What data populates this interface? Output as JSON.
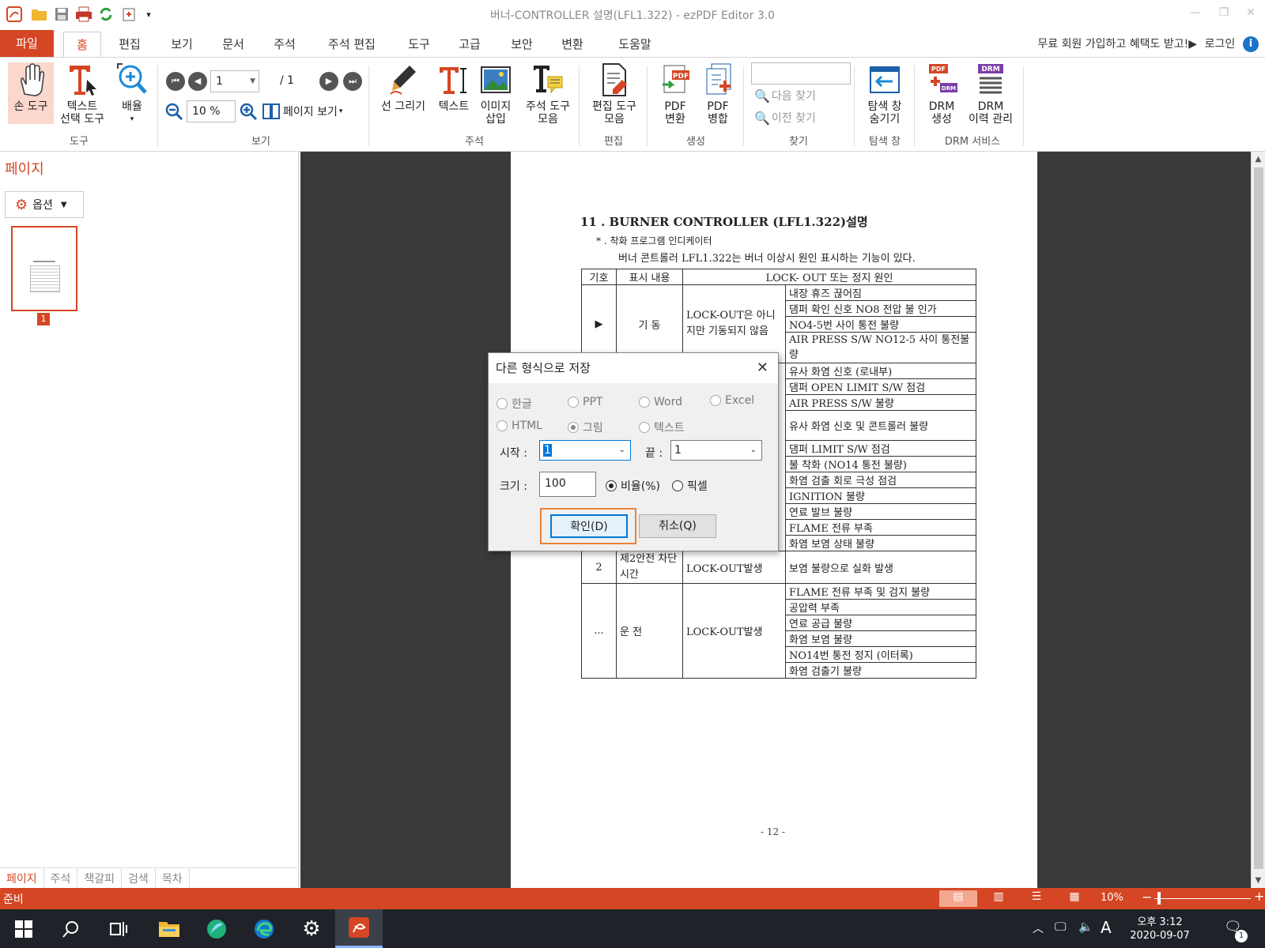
{
  "titlebar": {
    "title": "버너-CONTROLLER 설명(LFL1.322) - ezPDF Editor 3.0",
    "quick_access": [
      "app-logo-icon",
      "open-folder-icon",
      "save-icon",
      "print-icon",
      "refresh-icon",
      "new-doc-icon",
      "customize-dropdown-icon"
    ]
  },
  "menubar": {
    "file": "파일",
    "tabs": [
      "홈",
      "편집",
      "보기",
      "문서",
      "주석",
      "주석 편집",
      "도구",
      "고급",
      "보안",
      "변환",
      "도움말"
    ],
    "promo": "무료 회원 가입하고 혜택도 받고!▶",
    "login": "로그인"
  },
  "ribbon": {
    "hand_tool": "손 도구",
    "text_select_1": "텍스트",
    "text_select_2": "선택 도구",
    "zoom_1": "배율",
    "group_tools": "도구",
    "page_input": "1",
    "page_total": "/ 1",
    "zoom_value": "10 %",
    "page_view": "페이지 보기",
    "group_view": "보기",
    "line_draw": "선 그리기",
    "text": "텍스트",
    "image_insert_1": "이미지",
    "image_insert_2": "삽입",
    "note_tools_1": "주석 도구",
    "note_tools_2": "모음",
    "group_annot": "주석",
    "edit_tools_1": "편집 도구",
    "edit_tools_2": "모음",
    "group_edit": "편집",
    "pdf_convert_1": "PDF",
    "pdf_convert_2": "변환",
    "pdf_merge_1": "PDF",
    "pdf_merge_2": "병합",
    "group_create": "생성",
    "find_next": "다음 찾기",
    "find_prev": "이전 찾기",
    "group_find": "찾기",
    "hide_nav_1": "탐색 창",
    "hide_nav_2": "숨기기",
    "group_nav": "탐색 창",
    "drm_create_1": "DRM",
    "drm_create_2": "생성",
    "drm_history_1": "DRM",
    "drm_history_2": "이력 관리",
    "group_drm": "DRM 서비스",
    "pdf_badge": "PDF",
    "drm_badge": "DRM"
  },
  "leftpanel": {
    "title": "페이지",
    "options": "옵션",
    "thumb_num": "1",
    "bottom_tabs": [
      "페이지",
      "주석",
      "책갈피",
      "검색",
      "목차"
    ]
  },
  "document": {
    "heading": "11 . BURNER CONTROLLER (LFL1.322)설명",
    "sub1": "* . 착화 프로그램 인디케이터",
    "sub2": "버너 콘트롤러 LFL1.322는 버너 이상시 원인 표시하는 기능이 있다.",
    "header": [
      "기호",
      "표시 내용",
      "LOCK- OUT 또는 정지 원인"
    ],
    "sec1_symbol": "▶",
    "sec1_label": "기   동",
    "sec1_status": "LOCK-OUT은 아니지만 기동되지 않음",
    "sec1_causes": [
      "내장 휴즈 끊어짐",
      "댐퍼 확인 신호 NO8 전압 불 인가",
      "NO4-5번 사이 통전 불량",
      "AIR PRESS S/W NO12-5 사이 통전불량"
    ],
    "mid_causes": [
      "유사 화염 신호 (로내부)",
      "댐퍼 OPEN LIMIT S/W 점검",
      "AIR PRESS S/W 불량",
      "유사 화염 신호 및 콘트롤러 불량",
      "댐퍼 LIMIT S/W 점검",
      "불 착화 (NO14 통전 불량)",
      "화염 검출 회로 극성 점검",
      "IGNITION 불량",
      "연료 발브 불량",
      "FLAME 전류 부족",
      "화염 보염 상태 불량"
    ],
    "sec2_symbol": "2",
    "sec2_label": "제2안전 차단 시간",
    "sec2_status": "LOCK-OUT발생",
    "sec2_cause": "보염 불량으로 실화 발생",
    "sec3_symbol": "...",
    "sec3_label": "운   전",
    "sec3_status": "LOCK-OUT발생",
    "sec3_causes": [
      "FLAME 전류 부족 및 검지 불량",
      "공압력 부족",
      "연료 공급 불량",
      "화염 보염 불량",
      "NO14번 통전 정지 (이터록)",
      "화염 검출기 불량"
    ],
    "page_footer": "- 12 -"
  },
  "dialog": {
    "title": "다른 형식으로 저장",
    "formats": [
      {
        "label": "한글",
        "selected": false,
        "enabled": false
      },
      {
        "label": "PPT",
        "selected": false,
        "enabled": false
      },
      {
        "label": "Word",
        "selected": false,
        "enabled": false
      },
      {
        "label": "Excel",
        "selected": false,
        "enabled": false
      },
      {
        "label": "HTML",
        "selected": false,
        "enabled": false
      },
      {
        "label": "그림",
        "selected": true,
        "enabled": false
      },
      {
        "label": "텍스트",
        "selected": false,
        "enabled": false
      }
    ],
    "start_label": "시작 :",
    "start_value": "1",
    "end_label": "끝 :",
    "end_value": "1",
    "size_label": "크기 :",
    "size_value": "100",
    "ratio": "비율(%)",
    "pixel": "픽셀",
    "ok": "확인(D)",
    "cancel": "취소(Q)"
  },
  "statusbar": {
    "text": "준비",
    "zoom": "10%"
  },
  "taskbar": {
    "clock_time": "오후 3:12",
    "clock_date": "2020-09-07",
    "ime": "A",
    "notif_count": "1"
  },
  "colors": {
    "accent": "#d54624",
    "dialog_bg": "#f0f0f0",
    "focus_border": "#e8823a",
    "doc_bg": "#3a3a3a",
    "taskbar": "#1f2329"
  }
}
